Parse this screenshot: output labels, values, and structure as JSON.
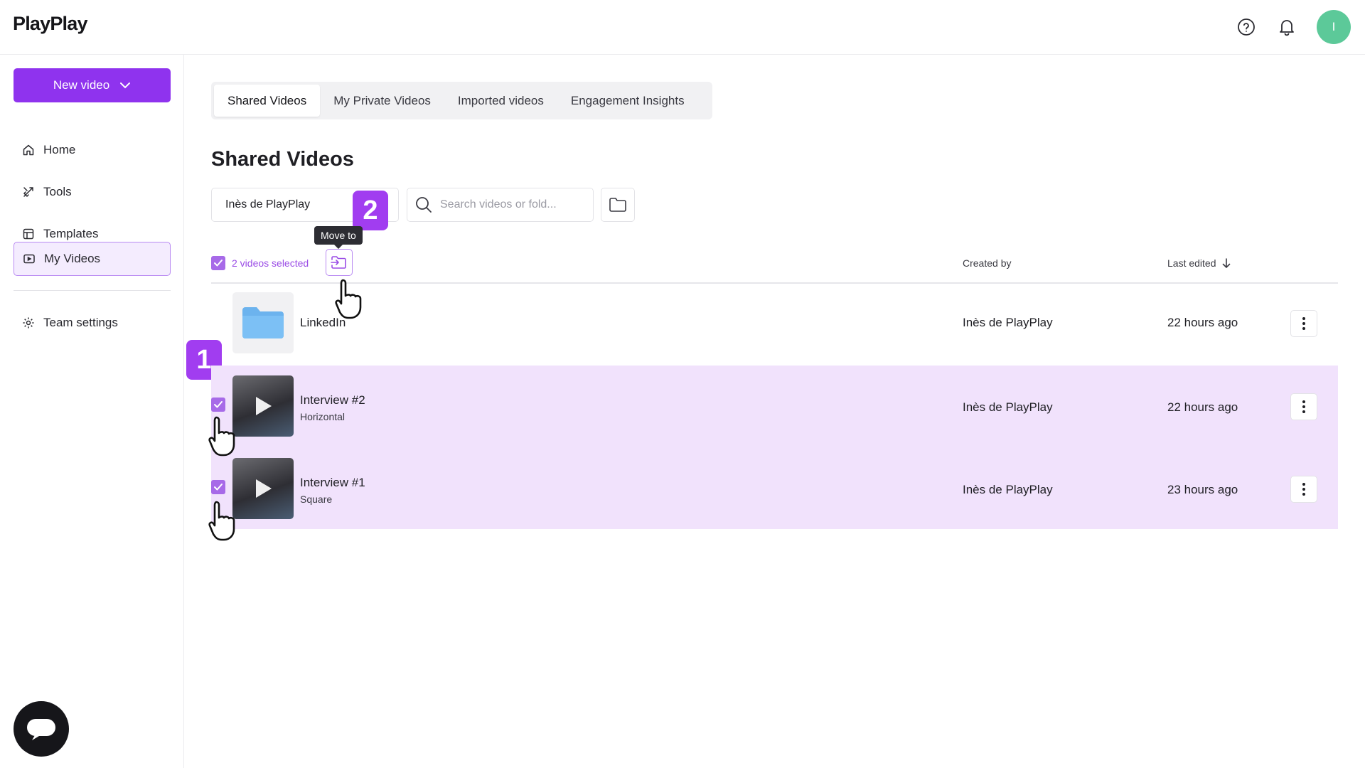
{
  "app": {
    "logo": "PlayPlay",
    "avatar_initial": "I"
  },
  "header": {
    "help_icon": "help-circle-icon",
    "bell_icon": "bell-icon"
  },
  "sidebar": {
    "new_video_label": "New video",
    "items": [
      {
        "label": "Home",
        "icon": "home-icon"
      },
      {
        "label": "Tools",
        "icon": "tools-icon"
      },
      {
        "label": "Templates",
        "icon": "templates-icon"
      },
      {
        "label": "My Videos",
        "icon": "video-icon",
        "active": true
      },
      {
        "label": "Team settings",
        "icon": "gear-icon"
      }
    ]
  },
  "tabs": [
    {
      "label": "Shared Videos",
      "active": true
    },
    {
      "label": "My Private Videos"
    },
    {
      "label": "Imported videos"
    },
    {
      "label": "Engagement Insights"
    }
  ],
  "main": {
    "title": "Shared Videos",
    "owner_filter": "Inès de PlayPlay",
    "search_placeholder": "Search videos or fold...",
    "tooltip": "Move to",
    "selected_text": "2 videos selected",
    "columns": {
      "created_by": "Created by",
      "last_edited": "Last edited"
    }
  },
  "badges": {
    "step1": "1",
    "step2": "2"
  },
  "rows": [
    {
      "type": "folder",
      "title": "LinkedIn",
      "subtitle": "",
      "created_by": "Inès de PlayPlay",
      "last_edited": "22 hours ago",
      "selected": false
    },
    {
      "type": "video",
      "title": "Interview #2",
      "subtitle": "Horizontal",
      "created_by": "Inès de PlayPlay",
      "last_edited": "22 hours ago",
      "selected": true
    },
    {
      "type": "video",
      "title": "Interview #1",
      "subtitle": "Square",
      "created_by": "Inès de PlayPlay",
      "last_edited": "23 hours ago",
      "selected": true
    }
  ],
  "colors": {
    "accent": "#8f33ee",
    "badge": "#a13df0",
    "selected_row": "#f1e2fc",
    "avatar": "#5cc999"
  }
}
